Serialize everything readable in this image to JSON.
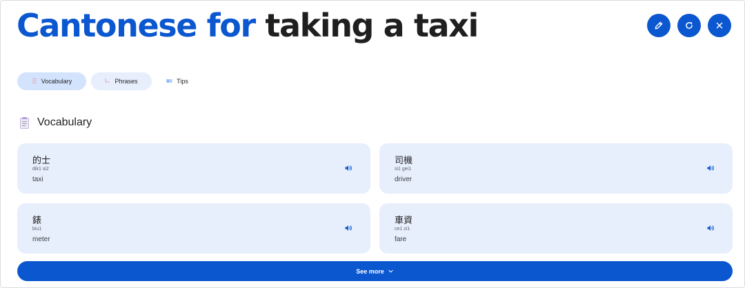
{
  "header": {
    "title_accent": "Cantonese for",
    "title_rest": "taking a taxi",
    "actions": [
      {
        "icon": "pencil-icon"
      },
      {
        "icon": "refresh-icon"
      },
      {
        "icon": "close-icon"
      }
    ]
  },
  "tabs": [
    {
      "icon": "list-icon",
      "label": "Vocabulary",
      "selected": true
    },
    {
      "icon": "speech-icon",
      "label": "Phrases",
      "selected": false
    },
    {
      "icon": "book-icon",
      "label": "Tips",
      "selected": false
    }
  ],
  "section": {
    "icon": "notepad-icon",
    "title": "Vocabulary"
  },
  "vocab": [
    {
      "hanzi": "的士",
      "jyutping": "dik1 si2",
      "english": "taxi"
    },
    {
      "hanzi": "司機",
      "jyutping": "si1 gei1",
      "english": "driver"
    },
    {
      "hanzi": "錶",
      "jyutping": "biu1",
      "english": "meter"
    },
    {
      "hanzi": "車資",
      "jyutping": "ce1 zi1",
      "english": "fare"
    }
  ],
  "see_more": {
    "label": "See more",
    "icon": "chevron-down-icon"
  },
  "colors": {
    "accent": "#0b57d0",
    "card_bg": "#e7eefc",
    "tab_selected_bg": "#d3e3fd"
  }
}
